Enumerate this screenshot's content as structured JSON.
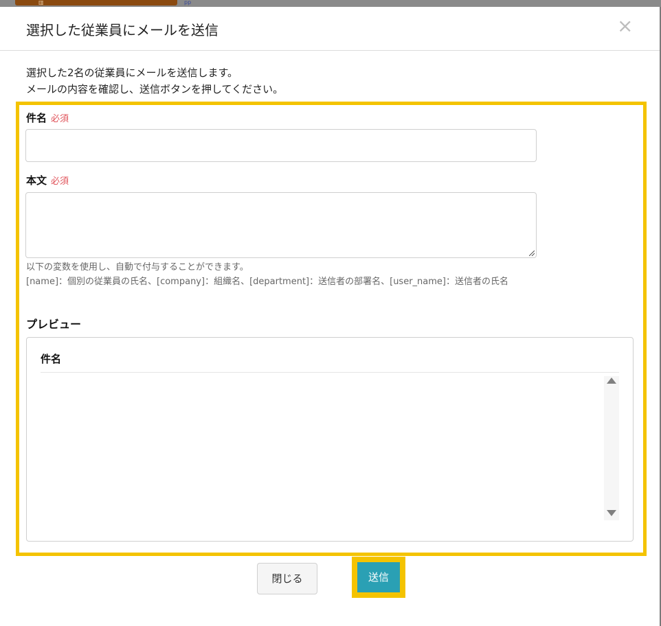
{
  "background": {
    "icon": "building-icon",
    "icon_glyph": "▥",
    "link_text": "pp"
  },
  "modal": {
    "title": "選択した従業員にメールを送信",
    "close_glyph": "×",
    "description": [
      "選択した2名の従業員にメールを送信します。",
      "メールの内容を確認し、送信ボタンを押してください。"
    ]
  },
  "form": {
    "subject": {
      "label": "件名",
      "required": "必須",
      "value": ""
    },
    "body": {
      "label": "本文",
      "required": "必須",
      "value": ""
    },
    "help": {
      "line1": "以下の変数を使用し、自動で付与することができます。",
      "line2": "[name]：個別の従業員の氏名、[company]：組織名、[department]：送信者の部署名、[user_name]：送信者の氏名"
    }
  },
  "preview": {
    "label": "プレビュー",
    "subject_heading": "件名",
    "body": ""
  },
  "buttons": {
    "close": "閉じる",
    "send": "送信"
  },
  "colors": {
    "highlight": "#f4c300",
    "send_button": "#2aa0b4",
    "required": "#e0535a"
  }
}
